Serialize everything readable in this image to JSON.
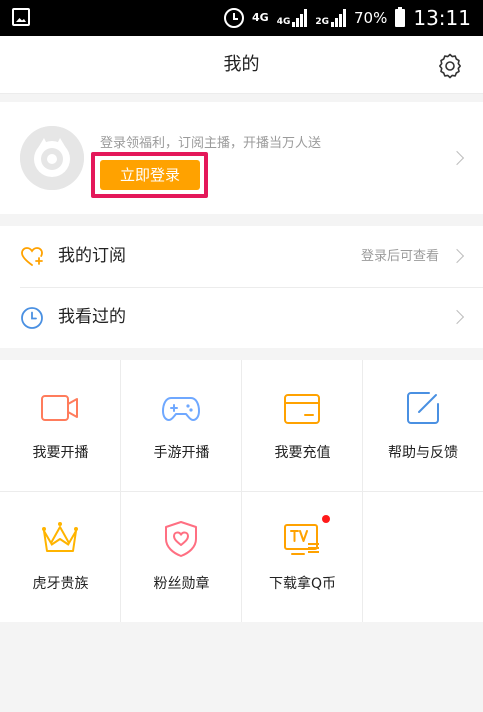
{
  "status_bar": {
    "network_4g": "4G",
    "network_4g_2": "4G",
    "network_2g": "2G",
    "battery": "70%",
    "time": "13:11"
  },
  "header": {
    "title": "我的"
  },
  "login": {
    "tip": "登录领福利，订阅主播，开播当万人送",
    "button": "立即登录"
  },
  "list": [
    {
      "label": "我的订阅",
      "hint": "登录后可查看",
      "icon": "heart-plus-icon"
    },
    {
      "label": "我看过的",
      "hint": "",
      "icon": "clock-icon"
    }
  ],
  "grid": [
    {
      "label": "我要开播",
      "icon": "video-camera-icon"
    },
    {
      "label": "手游开播",
      "icon": "gamepad-icon"
    },
    {
      "label": "我要充值",
      "icon": "wallet-icon"
    },
    {
      "label": "帮助与反馈",
      "icon": "edit-icon"
    },
    {
      "label": "虎牙贵族",
      "icon": "crown-icon"
    },
    {
      "label": "粉丝勋章",
      "icon": "shield-heart-icon"
    },
    {
      "label": "下载拿Q币",
      "icon": "tv-icon"
    }
  ],
  "colors": {
    "accent": "#ffa200",
    "highlight": "#e4185a",
    "video": "#ff7c5c",
    "game": "#6fa8ff",
    "wallet": "#ffa200",
    "edit": "#4a90e2",
    "crown": "#ffb400",
    "shield": "#ff6f82",
    "badge_dot": "#ff1a1a"
  }
}
